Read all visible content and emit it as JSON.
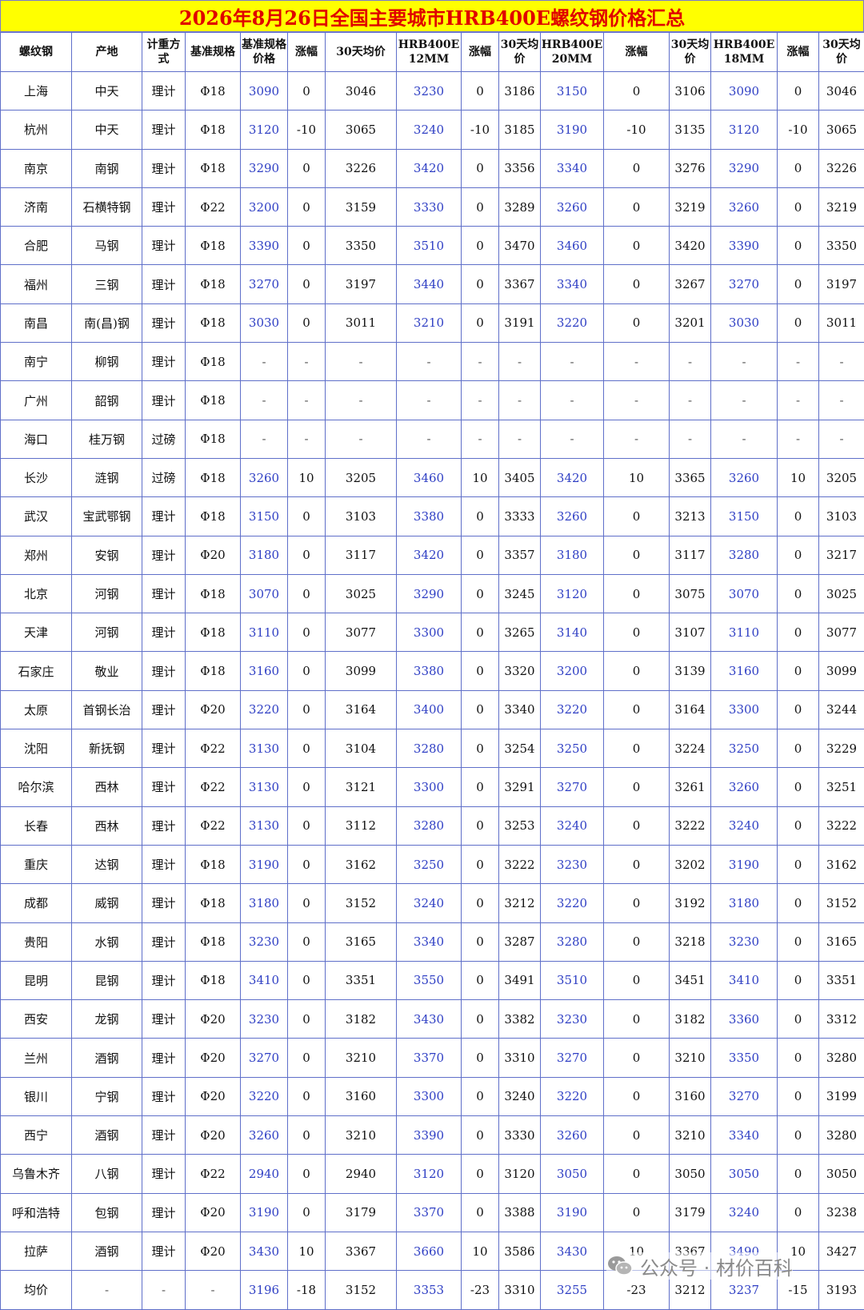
{
  "title": "2026年8月26日全国主要城市HRB400E螺纹钢价格汇总",
  "watermark": "公众号 · 材价百科",
  "columns": [
    "螺纹钢",
    "产地",
    "计重方式",
    "基准规格",
    "基准规格价格",
    "涨幅",
    "30天均价",
    "HRB400E 12MM",
    "涨幅",
    "30天均价",
    "HRB400E 20MM",
    "涨幅",
    "30天均价",
    "HRB400E 18MM",
    "涨幅",
    "30天均价"
  ],
  "blue_columns": [
    4,
    7,
    10,
    13
  ],
  "rows": [
    [
      "上海",
      "中天",
      "理计",
      "Φ18",
      "3090",
      "0",
      "3046",
      "3230",
      "0",
      "3186",
      "3150",
      "0",
      "3106",
      "3090",
      "0",
      "3046"
    ],
    [
      "杭州",
      "中天",
      "理计",
      "Φ18",
      "3120",
      "-10",
      "3065",
      "3240",
      "-10",
      "3185",
      "3190",
      "-10",
      "3135",
      "3120",
      "-10",
      "3065"
    ],
    [
      "南京",
      "南钢",
      "理计",
      "Φ18",
      "3290",
      "0",
      "3226",
      "3420",
      "0",
      "3356",
      "3340",
      "0",
      "3276",
      "3290",
      "0",
      "3226"
    ],
    [
      "济南",
      "石横特钢",
      "理计",
      "Φ22",
      "3200",
      "0",
      "3159",
      "3330",
      "0",
      "3289",
      "3260",
      "0",
      "3219",
      "3260",
      "0",
      "3219"
    ],
    [
      "合肥",
      "马钢",
      "理计",
      "Φ18",
      "3390",
      "0",
      "3350",
      "3510",
      "0",
      "3470",
      "3460",
      "0",
      "3420",
      "3390",
      "0",
      "3350"
    ],
    [
      "福州",
      "三钢",
      "理计",
      "Φ18",
      "3270",
      "0",
      "3197",
      "3440",
      "0",
      "3367",
      "3340",
      "0",
      "3267",
      "3270",
      "0",
      "3197"
    ],
    [
      "南昌",
      "南(昌)钢",
      "理计",
      "Φ18",
      "3030",
      "0",
      "3011",
      "3210",
      "0",
      "3191",
      "3220",
      "0",
      "3201",
      "3030",
      "0",
      "3011"
    ],
    [
      "南宁",
      "柳钢",
      "理计",
      "Φ18",
      "-",
      "-",
      "-",
      "-",
      "-",
      "-",
      "-",
      "-",
      "-",
      "-",
      "-",
      "-"
    ],
    [
      "广州",
      "韶钢",
      "理计",
      "Φ18",
      "-",
      "-",
      "-",
      "-",
      "-",
      "-",
      "-",
      "-",
      "-",
      "-",
      "-",
      "-"
    ],
    [
      "海口",
      "桂万钢",
      "过磅",
      "Φ18",
      "-",
      "-",
      "-",
      "-",
      "-",
      "-",
      "-",
      "-",
      "-",
      "-",
      "-",
      "-"
    ],
    [
      "长沙",
      "涟钢",
      "过磅",
      "Φ18",
      "3260",
      "10",
      "3205",
      "3460",
      "10",
      "3405",
      "3420",
      "10",
      "3365",
      "3260",
      "10",
      "3205"
    ],
    [
      "武汉",
      "宝武鄂钢",
      "理计",
      "Φ18",
      "3150",
      "0",
      "3103",
      "3380",
      "0",
      "3333",
      "3260",
      "0",
      "3213",
      "3150",
      "0",
      "3103"
    ],
    [
      "郑州",
      "安钢",
      "理计",
      "Φ20",
      "3180",
      "0",
      "3117",
      "3420",
      "0",
      "3357",
      "3180",
      "0",
      "3117",
      "3280",
      "0",
      "3217"
    ],
    [
      "北京",
      "河钢",
      "理计",
      "Φ18",
      "3070",
      "0",
      "3025",
      "3290",
      "0",
      "3245",
      "3120",
      "0",
      "3075",
      "3070",
      "0",
      "3025"
    ],
    [
      "天津",
      "河钢",
      "理计",
      "Φ18",
      "3110",
      "0",
      "3077",
      "3300",
      "0",
      "3265",
      "3140",
      "0",
      "3107",
      "3110",
      "0",
      "3077"
    ],
    [
      "石家庄",
      "敬业",
      "理计",
      "Φ18",
      "3160",
      "0",
      "3099",
      "3380",
      "0",
      "3320",
      "3200",
      "0",
      "3139",
      "3160",
      "0",
      "3099"
    ],
    [
      "太原",
      "首钢长治",
      "理计",
      "Φ20",
      "3220",
      "0",
      "3164",
      "3400",
      "0",
      "3340",
      "3220",
      "0",
      "3164",
      "3300",
      "0",
      "3244"
    ],
    [
      "沈阳",
      "新抚钢",
      "理计",
      "Φ22",
      "3130",
      "0",
      "3104",
      "3280",
      "0",
      "3254",
      "3250",
      "0",
      "3224",
      "3250",
      "0",
      "3229"
    ],
    [
      "哈尔滨",
      "西林",
      "理计",
      "Φ22",
      "3130",
      "0",
      "3121",
      "3300",
      "0",
      "3291",
      "3270",
      "0",
      "3261",
      "3260",
      "0",
      "3251"
    ],
    [
      "长春",
      "西林",
      "理计",
      "Φ22",
      "3130",
      "0",
      "3112",
      "3280",
      "0",
      "3253",
      "3240",
      "0",
      "3222",
      "3240",
      "0",
      "3222"
    ],
    [
      "重庆",
      "达钢",
      "理计",
      "Φ18",
      "3190",
      "0",
      "3162",
      "3250",
      "0",
      "3222",
      "3230",
      "0",
      "3202",
      "3190",
      "0",
      "3162"
    ],
    [
      "成都",
      "威钢",
      "理计",
      "Φ18",
      "3180",
      "0",
      "3152",
      "3240",
      "0",
      "3212",
      "3220",
      "0",
      "3192",
      "3180",
      "0",
      "3152"
    ],
    [
      "贵阳",
      "水钢",
      "理计",
      "Φ18",
      "3230",
      "0",
      "3165",
      "3340",
      "0",
      "3287",
      "3280",
      "0",
      "3218",
      "3230",
      "0",
      "3165"
    ],
    [
      "昆明",
      "昆钢",
      "理计",
      "Φ18",
      "3410",
      "0",
      "3351",
      "3550",
      "0",
      "3491",
      "3510",
      "0",
      "3451",
      "3410",
      "0",
      "3351"
    ],
    [
      "西安",
      "龙钢",
      "理计",
      "Φ20",
      "3230",
      "0",
      "3182",
      "3430",
      "0",
      "3382",
      "3230",
      "0",
      "3182",
      "3360",
      "0",
      "3312"
    ],
    [
      "兰州",
      "酒钢",
      "理计",
      "Φ20",
      "3270",
      "0",
      "3210",
      "3370",
      "0",
      "3310",
      "3270",
      "0",
      "3210",
      "3350",
      "0",
      "3280"
    ],
    [
      "银川",
      "宁钢",
      "理计",
      "Φ20",
      "3220",
      "0",
      "3160",
      "3300",
      "0",
      "3240",
      "3220",
      "0",
      "3160",
      "3270",
      "0",
      "3199"
    ],
    [
      "西宁",
      "酒钢",
      "理计",
      "Φ20",
      "3260",
      "0",
      "3210",
      "3390",
      "0",
      "3330",
      "3260",
      "0",
      "3210",
      "3340",
      "0",
      "3280"
    ],
    [
      "乌鲁木齐",
      "八钢",
      "理计",
      "Φ22",
      "2940",
      "0",
      "2940",
      "3120",
      "0",
      "3120",
      "3050",
      "0",
      "3050",
      "3050",
      "0",
      "3050"
    ],
    [
      "呼和浩特",
      "包钢",
      "理计",
      "Φ20",
      "3190",
      "0",
      "3179",
      "3370",
      "0",
      "3388",
      "3190",
      "0",
      "3179",
      "3240",
      "0",
      "3238"
    ],
    [
      "拉萨",
      "酒钢",
      "理计",
      "Φ20",
      "3430",
      "10",
      "3367",
      "3660",
      "10",
      "3586",
      "3430",
      "10",
      "3367",
      "3490",
      "10",
      "3427"
    ],
    [
      "均价",
      "-",
      "-",
      "-",
      "3196",
      "-18",
      "3152",
      "3353",
      "-23",
      "3310",
      "3255",
      "-23",
      "3212",
      "3237",
      "-15",
      "3193"
    ]
  ],
  "colors": {
    "title_bg": "#ffff00",
    "title_text": "#e00000",
    "price_text": "#2f3fc4",
    "border": "#5f6fc9"
  }
}
